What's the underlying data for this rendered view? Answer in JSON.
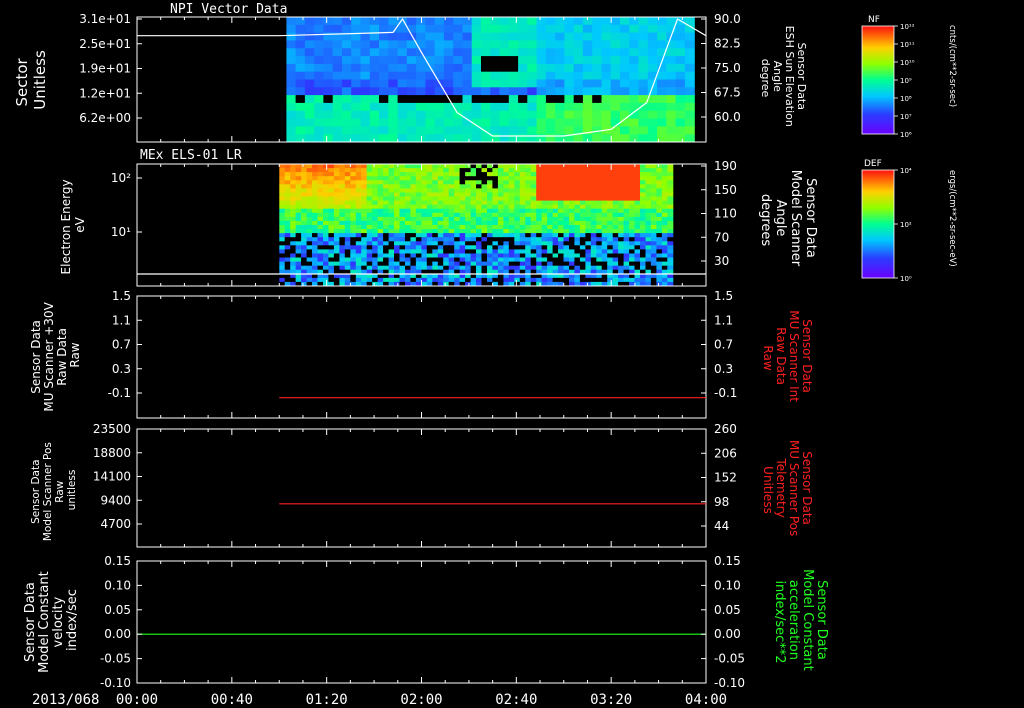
{
  "date_label": "2013/068",
  "time_ticks": [
    "00:00",
    "00:40",
    "01:20",
    "02:00",
    "02:40",
    "03:20",
    "04:00"
  ],
  "panel1": {
    "title": "NPI Vector Data",
    "left_label": [
      "Sector",
      "Unitless"
    ],
    "left_ticks": [
      "3.1e+01",
      "2.5e+01",
      "1.9e+01",
      "1.2e+01",
      "6.2e+00"
    ],
    "right_ticks": [
      "90.0",
      "82.5",
      "75.0",
      "67.5",
      "60.0"
    ],
    "right_label": [
      "Sensor Data",
      "ESH Sun Elevation",
      "Angle",
      "degree"
    ],
    "cbar_title": "NF",
    "cbar_ticks": [
      "10¹²",
      "10¹¹",
      "10¹⁰",
      "10⁹",
      "10⁸",
      "10⁷",
      "10⁶"
    ],
    "cbar_unit": "cnts/(cm**2-sr-sec)"
  },
  "panel2": {
    "title": "MEx ELS-01 LR",
    "left_label": [
      "Electron Energy",
      "eV"
    ],
    "left_ticks": [
      "10²",
      "10¹"
    ],
    "right_ticks": [
      "190",
      "150",
      "110",
      "70",
      "30"
    ],
    "right_label": [
      "Sensor Data",
      "Model Scanner",
      "Angle",
      "degrees"
    ],
    "cbar_title": "DEF",
    "cbar_ticks": [
      "10⁴",
      "10²",
      "10⁰"
    ],
    "cbar_unit": "ergs/(cm**2-sr-sec-eV)"
  },
  "panel3": {
    "left_label": [
      "Sensor Data",
      "MU Scanner +30V",
      "Raw Data",
      "Raw"
    ],
    "left_ticks": [
      "1.5",
      "1.1",
      "0.7",
      "0.3",
      "-0.1"
    ],
    "right_ticks": [
      "1.5",
      "1.1",
      "0.7",
      "0.3",
      "-0.1"
    ],
    "right_label": [
      "Sensor Data",
      "MU Scanner Int",
      "Raw Data",
      "Raw"
    ],
    "right_color": "#ff2020"
  },
  "panel4": {
    "left_label": [
      "Sensor Data",
      "Model Scanner Pos",
      "Raw",
      "unitless"
    ],
    "left_ticks": [
      "23500",
      "18800",
      "14100",
      "9400",
      "4700"
    ],
    "right_ticks": [
      "260",
      "206",
      "152",
      "98",
      "44"
    ],
    "right_label": [
      "Sensor Data",
      "MU Scanner Pos",
      "Telemetry",
      "Unitless"
    ],
    "right_color": "#ff2020"
  },
  "panel5": {
    "left_label": [
      "Sensor Data",
      "Model Constant",
      "velocity",
      "index/sec"
    ],
    "left_ticks": [
      "0.15",
      "0.10",
      "0.05",
      "0.00",
      "-0.05",
      "-0.10"
    ],
    "right_ticks": [
      "0.15",
      "0.10",
      "0.05",
      "0.00",
      "-0.05",
      "-0.10"
    ],
    "right_label": [
      "Sensor Data",
      "Model Constant",
      "acceleration",
      "index/sec**2"
    ],
    "right_color": "#20ff20"
  },
  "chart_data": [
    {
      "type": "heatmap",
      "title": "NPI Vector Data",
      "xlabel": "",
      "ylabel": "Sector Unitless",
      "y_right_label": "Sensor Data ESH Sun Elevation Angle degree",
      "x_range": [
        "00:00",
        "04:00"
      ],
      "ylim_right": [
        55,
        90
      ],
      "data_coverage": [
        "01:03",
        "03:55"
      ],
      "overlay_line": {
        "name": "ESH Sun Elevation",
        "color": "#ffffff",
        "x_minutes": [
          0,
          60,
          108,
          112,
          120,
          135,
          150,
          155,
          180,
          200,
          215,
          228,
          240
        ],
        "y": [
          85.0,
          85.0,
          86,
          90,
          80,
          62,
          55,
          55,
          55,
          57,
          65,
          90,
          85
        ]
      },
      "colorbar": {
        "label": "NF",
        "unit": "cnts/(cm**2-sr-sec)",
        "range": [
          "10⁶",
          "10¹²"
        ]
      }
    },
    {
      "type": "heatmap",
      "title": "MEx ELS-01 LR",
      "ylabel": "Electron Energy eV",
      "y_scale": "log",
      "y_right_label": "Sensor Data Model Scanner Angle degrees",
      "x_range": [
        "00:00",
        "04:00"
      ],
      "data_coverage": [
        "01:00",
        "03:46"
      ],
      "overlay_line": {
        "name": "Model Scanner Angle",
        "color": "#ffffff",
        "constant": 10
      },
      "colorbar": {
        "label": "DEF",
        "unit": "ergs/(cm**2-sr-sec-eV)",
        "range": [
          "10⁰",
          "10⁴"
        ]
      }
    },
    {
      "type": "line",
      "ylabel": "Sensor Data MU Scanner +30V Raw Data Raw",
      "y_right_label": "Sensor Data MU Scanner Int Raw Data Raw",
      "ylim": [
        -0.3,
        1.5
      ],
      "series": [
        {
          "name": "MU Scanner Int",
          "color": "#ff2020",
          "x_minutes": [
            60,
            240
          ],
          "y": [
            0.0,
            0.0
          ]
        }
      ]
    },
    {
      "type": "line",
      "ylabel": "Sensor Data Model Scanner Pos Raw unitless",
      "y_right_label": "Sensor Data MU Scanner Pos Telemetry Unitless",
      "ylim": [
        0,
        23500
      ],
      "series": [
        {
          "name": "MU Scanner Pos",
          "color": "#ff2020",
          "x_minutes": [
            60,
            240
          ],
          "y": [
            8600,
            8600
          ]
        }
      ]
    },
    {
      "type": "line",
      "ylabel": "Sensor Data Model Constant velocity index/sec",
      "y_right_label": "Sensor Data Model Constant acceleration index/sec**2",
      "ylim": [
        -0.1,
        0.15
      ],
      "series": [
        {
          "name": "Model Constant",
          "color": "#20ff20",
          "x_minutes": [
            0,
            240
          ],
          "y": [
            0.0,
            0.0
          ]
        }
      ]
    }
  ]
}
